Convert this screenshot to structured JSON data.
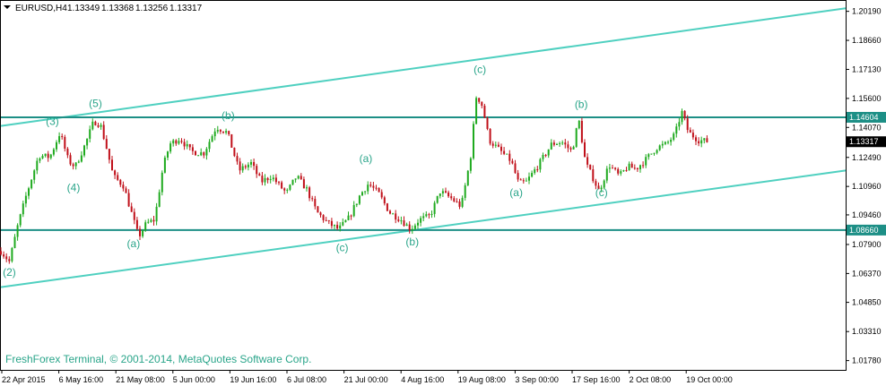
{
  "header": {
    "symbol": "EURUSD,H4",
    "open": "1.13349",
    "high": "1.13368",
    "low": "1.13256",
    "close": "1.13317"
  },
  "copyright": "FreshForex Terminal, © 2001-2014, MetaQuotes Software Corp.",
  "colors": {
    "bull": "#1faa1f",
    "bear": "#c0101a",
    "channel": "#4fd0c0",
    "horizontal": "#1d8f86",
    "label": "#2aa58a"
  },
  "chart_data": {
    "type": "line",
    "y_ticks": [
      "1.20190",
      "1.18660",
      "1.17130",
      "1.15600",
      "1.14070",
      "1.12490",
      "1.10960",
      "1.09460",
      "1.07900",
      "1.06370",
      "1.04850",
      "1.03310",
      "1.01780"
    ],
    "x_ticks": [
      "22 Apr 2015",
      "6 May 16:00",
      "21 May 08:00",
      "5 Jun 00:00",
      "19 Jun 16:00",
      "6 Jul 08:00",
      "21 Jul 00:00",
      "4 Aug 16:00",
      "19 Aug 08:00",
      "3 Sep 00:00",
      "17 Sep 16:00",
      "2 Oct 08:00",
      "19 Oct 00:00"
    ],
    "ylim": [
      1.0129,
      1.2074
    ],
    "price_tags": [
      {
        "label": "1.14604",
        "value": 1.14604,
        "style": "horizontal"
      },
      {
        "label": "1.13317",
        "value": 1.13317,
        "style": "current"
      },
      {
        "label": "1.08660",
        "value": 1.0866,
        "style": "horizontal"
      }
    ],
    "horizontal_lines": [
      1.14604,
      1.0866
    ],
    "channel_lines": [
      {
        "start": [
          0,
          1.1415
        ],
        "end": [
          1,
          1.2035
        ]
      },
      {
        "start": [
          0,
          1.0565
        ],
        "end": [
          1,
          1.118
        ]
      }
    ],
    "series": [
      {
        "values": [
          [
            0.0,
            1.0755
          ],
          [
            0.01,
            1.07
          ],
          [
            0.02,
            1.089
          ],
          [
            0.03,
            1.105
          ],
          [
            0.045,
            1.126
          ],
          [
            0.058,
            1.125
          ],
          [
            0.07,
            1.138
          ],
          [
            0.08,
            1.123
          ],
          [
            0.088,
            1.12
          ],
          [
            0.1,
            1.132
          ],
          [
            0.11,
            1.144
          ],
          [
            0.118,
            1.142
          ],
          [
            0.125,
            1.13
          ],
          [
            0.133,
            1.115
          ],
          [
            0.145,
            1.11
          ],
          [
            0.155,
            1.095
          ],
          [
            0.163,
            1.083
          ],
          [
            0.172,
            1.09
          ],
          [
            0.182,
            1.092
          ],
          [
            0.192,
            1.12
          ],
          [
            0.2,
            1.132
          ],
          [
            0.212,
            1.135
          ],
          [
            0.225,
            1.128
          ],
          [
            0.24,
            1.127
          ],
          [
            0.255,
            1.141
          ],
          [
            0.268,
            1.138
          ],
          [
            0.282,
            1.118
          ],
          [
            0.296,
            1.122
          ],
          [
            0.308,
            1.112
          ],
          [
            0.32,
            1.115
          ],
          [
            0.338,
            1.106
          ],
          [
            0.35,
            1.115
          ],
          [
            0.362,
            1.108
          ],
          [
            0.374,
            1.096
          ],
          [
            0.388,
            1.09
          ],
          [
            0.4,
            1.087
          ],
          [
            0.412,
            1.093
          ],
          [
            0.425,
            1.105
          ],
          [
            0.435,
            1.111
          ],
          [
            0.447,
            1.106
          ],
          [
            0.46,
            1.096
          ],
          [
            0.474,
            1.092
          ],
          [
            0.485,
            1.087
          ],
          [
            0.495,
            1.092
          ],
          [
            0.508,
            1.094
          ],
          [
            0.52,
            1.107
          ],
          [
            0.534,
            1.103
          ],
          [
            0.545,
            1.099
          ],
          [
            0.556,
            1.125
          ],
          [
            0.563,
            1.158
          ],
          [
            0.57,
            1.152
          ],
          [
            0.578,
            1.134
          ],
          [
            0.592,
            1.128
          ],
          [
            0.604,
            1.123
          ],
          [
            0.613,
            1.111
          ],
          [
            0.622,
            1.112
          ],
          [
            0.638,
            1.122
          ],
          [
            0.652,
            1.132
          ],
          [
            0.664,
            1.133
          ],
          [
            0.676,
            1.128
          ],
          [
            0.684,
            1.145
          ],
          [
            0.692,
            1.122
          ],
          [
            0.7,
            1.115
          ],
          [
            0.708,
            1.107
          ],
          [
            0.72,
            1.121
          ],
          [
            0.732,
            1.115
          ],
          [
            0.742,
            1.12
          ],
          [
            0.752,
            1.119
          ],
          [
            0.764,
            1.124
          ],
          [
            0.776,
            1.13
          ],
          [
            0.788,
            1.132
          ],
          [
            0.798,
            1.137
          ],
          [
            0.806,
            1.149
          ],
          [
            0.814,
            1.138
          ],
          [
            0.826,
            1.134
          ],
          [
            0.838,
            1.1332
          ]
        ]
      }
    ],
    "annotations": [
      {
        "text": "(2)",
        "x": 0.01,
        "y": 1.0625
      },
      {
        "text": "(3)",
        "x": 0.061,
        "y": 1.142
      },
      {
        "text": "(4)",
        "x": 0.086,
        "y": 1.107
      },
      {
        "text": "(5)",
        "x": 0.112,
        "y": 1.1515
      },
      {
        "text": "(a)",
        "x": 0.157,
        "y": 1.0775
      },
      {
        "text": "(b)",
        "x": 0.269,
        "y": 1.145
      },
      {
        "text": "(a)",
        "x": 0.432,
        "y": 1.1225
      },
      {
        "text": "(c)",
        "x": 0.404,
        "y": 1.0755
      },
      {
        "text": "(b)",
        "x": 0.487,
        "y": 1.0785
      },
      {
        "text": "(c)",
        "x": 0.567,
        "y": 1.1695
      },
      {
        "text": "(a)",
        "x": 0.61,
        "y": 1.1045
      },
      {
        "text": "(b)",
        "x": 0.687,
        "y": 1.151
      },
      {
        "text": "(c)",
        "x": 0.711,
        "y": 1.1045
      }
    ]
  }
}
